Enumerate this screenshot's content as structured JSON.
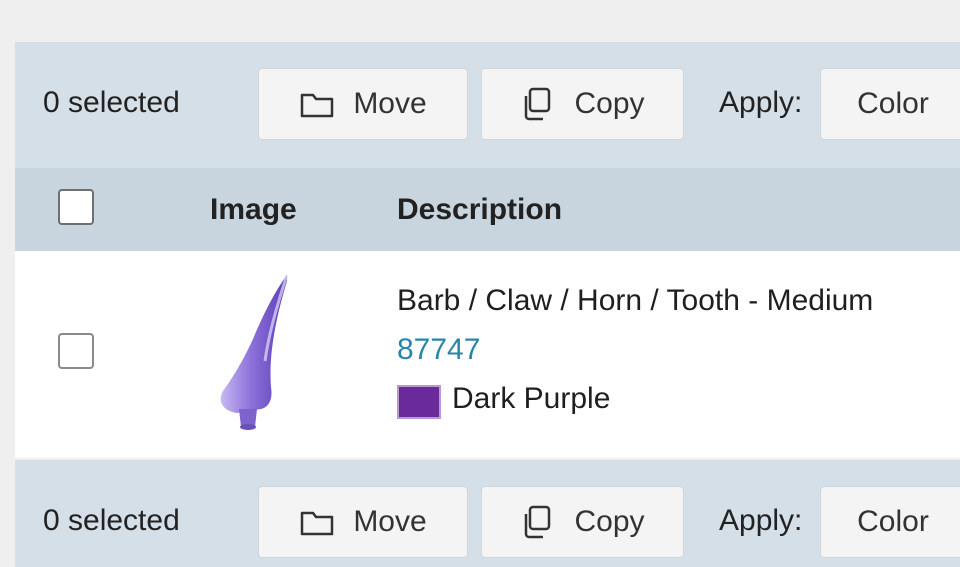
{
  "top_toolbar": {
    "selected_count": "0 selected",
    "move_label": "Move",
    "copy_label": "Copy",
    "apply_label": "Apply:",
    "color_label": "Color"
  },
  "table": {
    "columns": {
      "image": "Image",
      "description": "Description"
    },
    "rows": [
      {
        "title": "Barb / Claw / Horn / Tooth - Medium",
        "part_number": "87747",
        "color_name": "Dark Purple",
        "color_hex": "#6a2a9b"
      }
    ]
  },
  "bottom_toolbar": {
    "selected_count": "0 selected",
    "move_label": "Move",
    "copy_label": "Copy",
    "apply_label": "Apply:",
    "color_label": "Color"
  },
  "colors": {
    "toolbar_bg": "#d4dfe8",
    "header_bg": "#c8d4de",
    "link": "#2a86a8",
    "part_color": "#8a6ad8"
  }
}
